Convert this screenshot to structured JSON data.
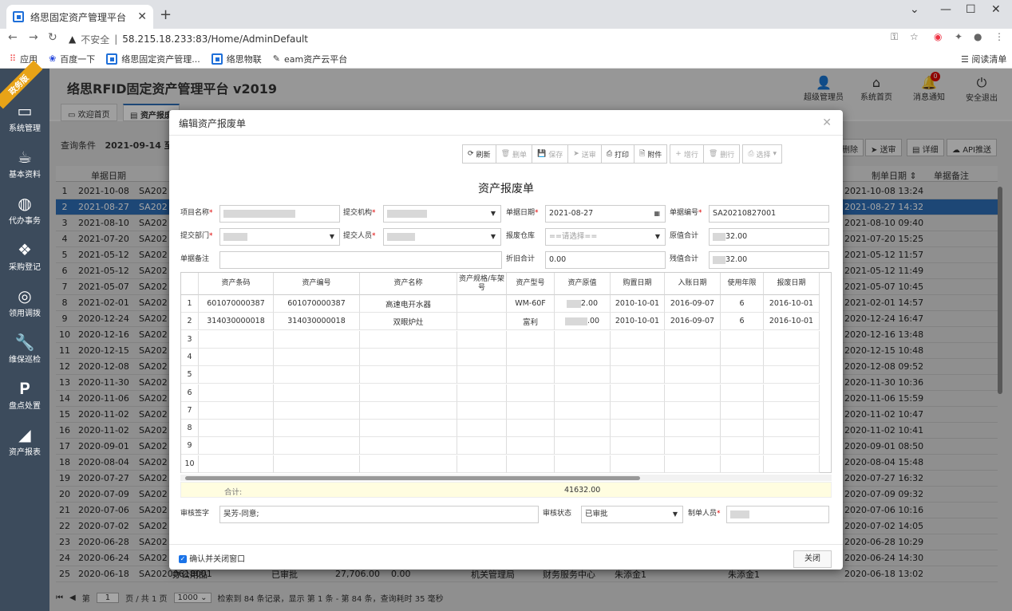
{
  "browser": {
    "tab_title": "络思固定资产管理平台",
    "url_insecure": "不安全",
    "url": "58.215.18.233:83/Home/AdminDefault",
    "bookmarks": [
      "应用",
      "百度一下",
      "络思固定资产管理...",
      "络思物联",
      "eam资产云平台"
    ],
    "reading_list": "阅读清单"
  },
  "app": {
    "title": "络思RFID固定资产管理平台 v2019",
    "ribbon": "政务版",
    "header_icons": [
      {
        "label": "超级管理员",
        "icon": "user-icon"
      },
      {
        "label": "系统首页",
        "icon": "home-icon"
      },
      {
        "label": "消息通知",
        "icon": "bell-icon",
        "badge": "0"
      },
      {
        "label": "安全退出",
        "icon": "power-icon"
      }
    ],
    "sidebar": [
      "系统管理",
      "基本资料",
      "代办事务",
      "采购登记",
      "领用调拨",
      "维保巡检",
      "盘点处置",
      "资产报表"
    ],
    "page_tabs": [
      "欢迎首页",
      "资产报废"
    ]
  },
  "background": {
    "query_label": "查询条件",
    "query_value": "2021-09-14 至 20",
    "buttons": [
      "删除",
      "送审",
      "详细",
      "API推送"
    ],
    "headers": {
      "date": "单据日期",
      "maker_date": "制单日期",
      "note": "单据备注"
    },
    "rows": [
      {
        "n": "1",
        "d": "2021-10-08",
        "c": "SA202",
        "r": "2021-10-08 13:24"
      },
      {
        "n": "2",
        "d": "2021-08-27",
        "c": "SA202",
        "r": "2021-08-27 14:32"
      },
      {
        "n": "3",
        "d": "2021-08-10",
        "c": "SA202",
        "r": "2021-08-10 09:40"
      },
      {
        "n": "4",
        "d": "2021-07-20",
        "c": "SA202",
        "r": "2021-07-20 15:25"
      },
      {
        "n": "5",
        "d": "2021-05-12",
        "c": "SA202",
        "r": "2021-05-12 11:57"
      },
      {
        "n": "6",
        "d": "2021-05-12",
        "c": "SA202",
        "r": "2021-05-12 11:49"
      },
      {
        "n": "7",
        "d": "2021-05-07",
        "c": "SA202",
        "r": "2021-05-07 10:45"
      },
      {
        "n": "8",
        "d": "2021-02-01",
        "c": "SA202",
        "r": "2021-02-01 14:57"
      },
      {
        "n": "9",
        "d": "2020-12-24",
        "c": "SA202",
        "r": "2020-12-24 16:47"
      },
      {
        "n": "10",
        "d": "2020-12-16",
        "c": "SA202",
        "r": "2020-12-16 13:48"
      },
      {
        "n": "11",
        "d": "2020-12-15",
        "c": "SA202",
        "r": "2020-12-15 10:48"
      },
      {
        "n": "12",
        "d": "2020-12-08",
        "c": "SA202",
        "r": "2020-12-08 09:52"
      },
      {
        "n": "13",
        "d": "2020-11-30",
        "c": "SA202",
        "r": "2020-11-30 10:36"
      },
      {
        "n": "14",
        "d": "2020-11-06",
        "c": "SA202",
        "r": "2020-11-06 15:59"
      },
      {
        "n": "15",
        "d": "2020-11-02",
        "c": "SA202",
        "r": "2020-11-02 10:47"
      },
      {
        "n": "16",
        "d": "2020-11-02",
        "c": "SA202",
        "r": "2020-11-02 10:41"
      },
      {
        "n": "17",
        "d": "2020-09-01",
        "c": "SA202",
        "r": "2020-09-01 08:50"
      },
      {
        "n": "18",
        "d": "2020-08-04",
        "c": "SA202",
        "r": "2020-08-04 15:48"
      },
      {
        "n": "19",
        "d": "2020-07-27",
        "c": "SA202",
        "r": "2020-07-27 16:32"
      },
      {
        "n": "20",
        "d": "2020-07-09",
        "c": "SA202",
        "r": "2020-07-09 09:32"
      },
      {
        "n": "21",
        "d": "2020-07-06",
        "c": "SA202",
        "r": "2020-07-06 10:16"
      },
      {
        "n": "22",
        "d": "2020-07-02",
        "c": "SA202",
        "r": "2020-07-02 14:05"
      },
      {
        "n": "23",
        "d": "2020-06-28",
        "c": "SA202",
        "r": "2020-06-28 10:29"
      },
      {
        "n": "24",
        "d": "2020-06-24",
        "c": "SA202",
        "r": "2020-06-24 14:30"
      },
      {
        "n": "25",
        "d": "2020-06-18",
        "c": "SA20200618001",
        "r": "2020-06-18 13:02"
      }
    ],
    "row25_extra": [
      "办公用品",
      "已审批",
      "27,706.00",
      "0.00",
      "机关管理局",
      "财务服务中心",
      "朱添金1",
      "朱添金1"
    ],
    "footer": {
      "page_label": "第",
      "page": "1",
      "of": "页 / 共 1 页",
      "page_size": "1000",
      "summary": "检索到 84 条记录，显示 第 1 条 - 第 84 条，查询耗时 35 毫秒"
    }
  },
  "modal": {
    "title": "编辑资产报废单",
    "toolbar": [
      "刷新",
      "删单",
      "保存",
      "送审",
      "打印",
      "附件",
      "增行",
      "删行",
      "选择"
    ],
    "doc_title": "资产报废单",
    "fields": {
      "project_name": "项目名称",
      "submit_org": "提交机构",
      "doc_date": "单据日期",
      "doc_date_value": "2021-08-27",
      "doc_no": "单据编号",
      "doc_no_value": "SA20210827001",
      "submit_dept": "提交部门",
      "submitter": "提交人员",
      "warehouse": "报废仓库",
      "warehouse_placeholder": "==请选择==",
      "orig_total": "原值合计",
      "orig_total_value": "32.00",
      "note": "单据备注",
      "depr_total": "折旧合计",
      "depr_total_value": "0.00",
      "residual_total": "残值合计",
      "residual_total_value": "32.00"
    },
    "grid": {
      "headers": [
        "资产条码",
        "资产编号",
        "资产名称",
        "资产规格/车架号",
        "资产型号",
        "资产原值",
        "购置日期",
        "入账日期",
        "使用年限",
        "报废日期"
      ],
      "rows": [
        [
          "1",
          "601070000387",
          "601070000387",
          "高速电开水器",
          "",
          "WM-60F",
          "2.00",
          "2010-10-01",
          "2016-09-07",
          "6",
          "2016-10-01"
        ],
        [
          "2",
          "314030000018",
          "314030000018",
          "双眼炉灶",
          "",
          "富利",
          ".00",
          "2010-10-01",
          "2016-09-07",
          "6",
          "2016-10-01"
        ],
        [
          "3"
        ],
        [
          "4"
        ],
        [
          "5"
        ],
        [
          "6"
        ],
        [
          "7"
        ],
        [
          "8"
        ],
        [
          "9"
        ],
        [
          "10"
        ]
      ],
      "sum_label": "合计:",
      "sum_value": "41632.00"
    },
    "audit": {
      "sign_label": "审核签字",
      "sign_value": "吴芳-同意;",
      "status_label": "审核状态",
      "status_value": "已审批",
      "maker_label": "制单人员"
    },
    "confirm_close": "确认并关闭窗口",
    "close_button": "关闭"
  },
  "colors": {
    "accent": "#2d6db5",
    "sidebar": "#3c4b5c",
    "ribbon": "#e8a317"
  }
}
